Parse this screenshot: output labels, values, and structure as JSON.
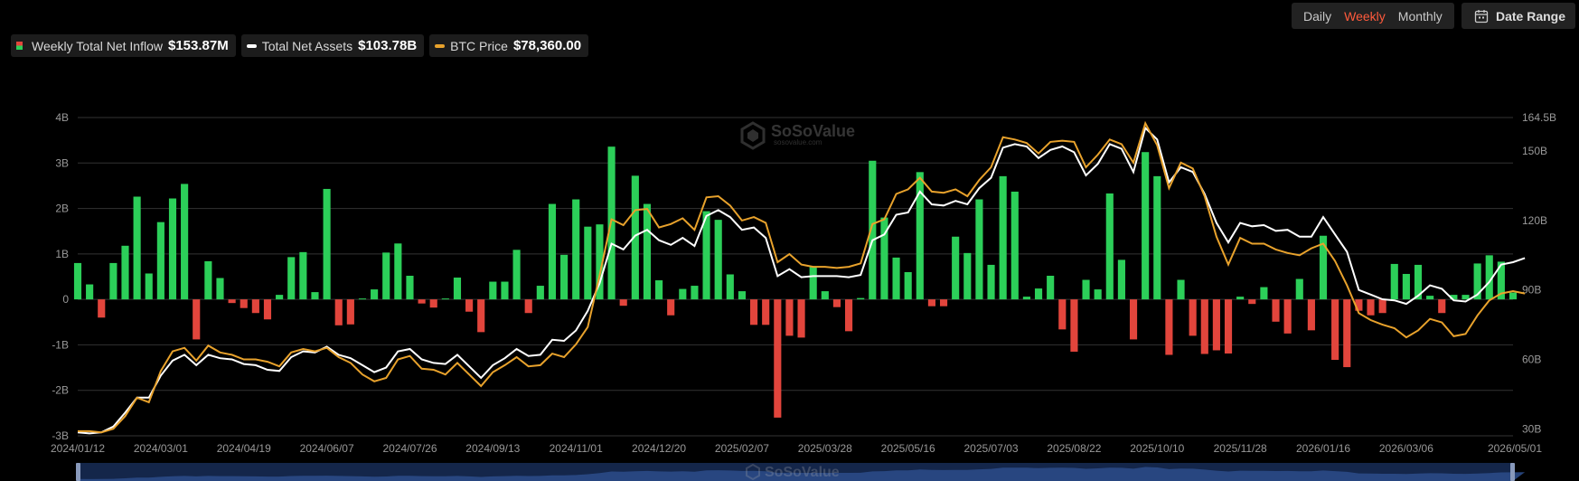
{
  "legend": [
    {
      "name": "weekly-inflow",
      "label": "Weekly Total Net Inflow",
      "value": "$153.87M",
      "swatch": "bar"
    },
    {
      "name": "net-assets",
      "label": "Total Net Assets",
      "value": "$103.78B",
      "swatch": "line",
      "color": "#ffffff"
    },
    {
      "name": "btc-price",
      "label": "BTC Price",
      "value": "$78,360.00",
      "swatch": "line",
      "color": "#e8a22c"
    }
  ],
  "period_tabs": [
    {
      "label": "Daily",
      "active": false
    },
    {
      "label": "Weekly",
      "active": true
    },
    {
      "label": "Monthly",
      "active": false
    }
  ],
  "date_range_label": "Date Range",
  "watermark": "SoSoValue",
  "watermark_sub": "sosovalue.com",
  "colors": {
    "positive": "#2ccf59",
    "negative": "#e2453c",
    "assets_line": "#ffffff",
    "price_line": "#e8a22c",
    "grid": "#333333",
    "navigator": "#14264a"
  },
  "chart_data": {
    "type": "bar+line",
    "categories": [
      "2024/01/12",
      "2024/03/01",
      "2024/04/19",
      "2024/06/07",
      "2024/07/26",
      "2024/09/13",
      "2024/11/01",
      "2024/12/20",
      "2025/02/07",
      "2025/03/28",
      "2025/05/16",
      "2025/07/03",
      "2025/08/22",
      "2025/10/10",
      "2025/11/28",
      "2026/01/16",
      "2026/03/06",
      "2026/05/01"
    ],
    "x_tick_positions": [
      0,
      7,
      14,
      21,
      28,
      35,
      42,
      49,
      56,
      63,
      70,
      77,
      84,
      91,
      98,
      105,
      112,
      120
    ],
    "y_left": {
      "ticks": [
        "-3B",
        "-2B",
        "-1B",
        "0",
        "1B",
        "2B",
        "3B",
        "4B"
      ],
      "range": [
        -3,
        4
      ],
      "unit": "B"
    },
    "y_right": {
      "ticks": [
        "30B",
        "60B",
        "90B",
        "120B",
        "150B",
        "164.5B"
      ],
      "range": [
        27,
        164.5
      ],
      "unit": "B"
    },
    "grid": true,
    "series": [
      {
        "name": "Weekly Total Net Inflow",
        "type": "bar",
        "axis": "left",
        "values": [
          0.8,
          0.33,
          -0.4,
          0.8,
          1.18,
          2.26,
          0.57,
          1.7,
          2.22,
          2.54,
          -0.88,
          0.84,
          0.47,
          -0.08,
          -0.19,
          -0.3,
          -0.44,
          0.1,
          0.93,
          1.04,
          0.16,
          2.43,
          -0.57,
          -0.55,
          0.0,
          0.22,
          1.03,
          1.23,
          0.52,
          -0.09,
          -0.18,
          0.02,
          0.48,
          -0.27,
          -0.72,
          0.39,
          0.39,
          1.09,
          -0.3,
          0.3,
          2.1,
          0.98,
          2.2,
          1.6,
          1.65,
          3.36,
          -0.14,
          2.72,
          2.1,
          0.42,
          -0.35,
          0.23,
          0.3,
          1.94,
          1.75,
          0.55,
          0.18,
          -0.56,
          -0.56,
          -2.6,
          -0.8,
          -0.84,
          0.73,
          0.18,
          -0.17,
          -0.7,
          0.03,
          3.05,
          1.8,
          0.92,
          0.6,
          2.8,
          -0.15,
          -0.15,
          1.38,
          1.02,
          2.2,
          0.76,
          2.71,
          2.37,
          0.06,
          0.24,
          0.52,
          -0.66,
          -1.15,
          0.43,
          0.22,
          2.33,
          0.87,
          -0.88,
          3.24,
          2.71,
          -1.22,
          0.43,
          -0.8,
          -1.2,
          -1.12,
          -1.19,
          0.06,
          -0.1,
          0.27,
          -0.49,
          -0.75,
          0.45,
          -0.68,
          1.4,
          -1.33,
          -1.49,
          -0.25,
          -0.35,
          -0.3,
          0.78,
          0.56,
          0.76,
          0.08,
          -0.3,
          0.1,
          0.1,
          0.79,
          0.97,
          0.83,
          0.15
        ]
      },
      {
        "name": "Total Net Assets",
        "type": "line",
        "axis": "right",
        "values": [
          28.5,
          28.0,
          28.5,
          31.0,
          37.0,
          43.5,
          43.5,
          53.0,
          59.5,
          62.0,
          57.5,
          62.0,
          60.5,
          60.0,
          58.0,
          57.5,
          55.5,
          55.0,
          61.0,
          63.5,
          63.0,
          65.5,
          62.0,
          60.5,
          57.5,
          54.5,
          56.5,
          63.5,
          64.5,
          60.0,
          58.5,
          58.0,
          62.0,
          57.0,
          52.0,
          57.5,
          60.5,
          64.5,
          61.5,
          62.0,
          68.5,
          68.0,
          72.5,
          81.0,
          93.0,
          110.0,
          107.5,
          113.5,
          116.0,
          111.5,
          109.5,
          112.5,
          109.0,
          122.0,
          124.5,
          121.5,
          116.0,
          117.0,
          112.5,
          96.0,
          99.0,
          95.5,
          96.0,
          96.0,
          96.0,
          95.5,
          96.5,
          111.5,
          114.0,
          122.5,
          123.5,
          132.5,
          127.0,
          126.5,
          128.5,
          127.0,
          134.0,
          138.5,
          151.5,
          153.0,
          152.0,
          147.0,
          150.5,
          152.0,
          149.5,
          139.5,
          144.5,
          153.0,
          151.0,
          141.0,
          160.0,
          155.0,
          136.5,
          143.0,
          141.0,
          131.5,
          119.0,
          110.5,
          119.0,
          117.5,
          118.0,
          115.5,
          116.0,
          113.0,
          113.0,
          121.5,
          114.0,
          106.5,
          90.0,
          88.0,
          86.0,
          85.5,
          84.0,
          87.5,
          92.0,
          90.5,
          85.5,
          85.0,
          88.0,
          93.5,
          101.0,
          102.0,
          103.8
        ]
      },
      {
        "name": "BTC Price",
        "type": "line",
        "axis": "right",
        "values": [
          29.0,
          29.0,
          28.5,
          30.0,
          35.5,
          43.5,
          41.5,
          55.0,
          63.5,
          65.0,
          59.5,
          66.0,
          63.0,
          62.0,
          60.0,
          60.0,
          59.0,
          57.0,
          63.0,
          64.5,
          63.5,
          65.0,
          61.0,
          58.5,
          53.5,
          50.5,
          52.0,
          60.0,
          61.5,
          56.0,
          55.5,
          53.5,
          58.5,
          53.5,
          48.5,
          54.5,
          57.5,
          61.0,
          57.0,
          57.5,
          62.5,
          61.0,
          66.5,
          74.0,
          96.5,
          120.5,
          118.0,
          124.5,
          125.0,
          117.0,
          118.5,
          121.0,
          116.0,
          130.0,
          130.5,
          126.5,
          120.0,
          121.5,
          119.0,
          102.0,
          105.5,
          101.0,
          100.0,
          100.0,
          99.5,
          100.0,
          101.5,
          118.5,
          120.5,
          131.5,
          133.5,
          138.5,
          132.5,
          132.0,
          133.5,
          130.5,
          137.5,
          143.0,
          156.0,
          155.0,
          153.5,
          149.0,
          154.0,
          154.5,
          154.0,
          143.0,
          148.5,
          155.0,
          153.0,
          145.0,
          162.0,
          152.5,
          134.0,
          145.0,
          142.5,
          130.5,
          113.0,
          101.0,
          112.5,
          110.0,
          110.0,
          107.5,
          106.0,
          105.0,
          108.0,
          110.0,
          102.5,
          92.0,
          80.0,
          77.0,
          75.0,
          73.5,
          69.5,
          72.5,
          77.5,
          76.0,
          70.0,
          71.0,
          79.0,
          85.5,
          88.5,
          89.5,
          88.5
        ]
      }
    ]
  }
}
